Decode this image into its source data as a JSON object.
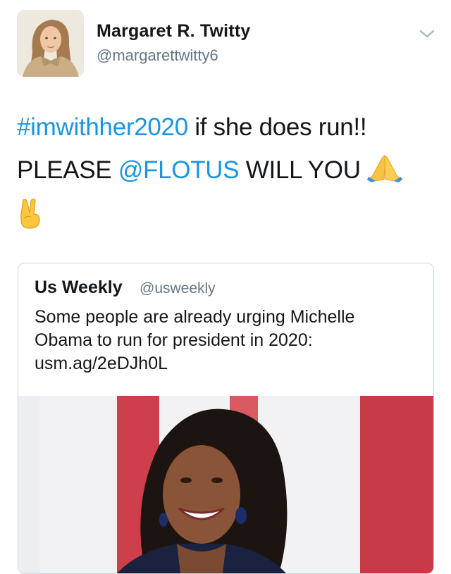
{
  "tweet": {
    "author": {
      "name": "Margaret R. Twitty",
      "handle": "@margarettwitty6",
      "avatar_icon": "profile-photo"
    },
    "menu_icon": "chevron-down-icon",
    "text": {
      "hashtag": "#imwithher2020",
      "part1": " if she does run!!",
      "part2": "PLEASE ",
      "mention": "@FLOTUS",
      "part3": " WILL YOU ",
      "emoji1": "🙏",
      "emoji2": "✌️"
    },
    "link_color": "#1b95e0"
  },
  "quoted_tweet": {
    "name": "Us Weekly",
    "handle": "@usweekly",
    "text_line1": "Some people are already urging Michelle",
    "text_line2": "Obama to run for president in 2020:",
    "text_line3": "usm.ag/2eDJh0L",
    "image_icon": "portrait-photo"
  }
}
